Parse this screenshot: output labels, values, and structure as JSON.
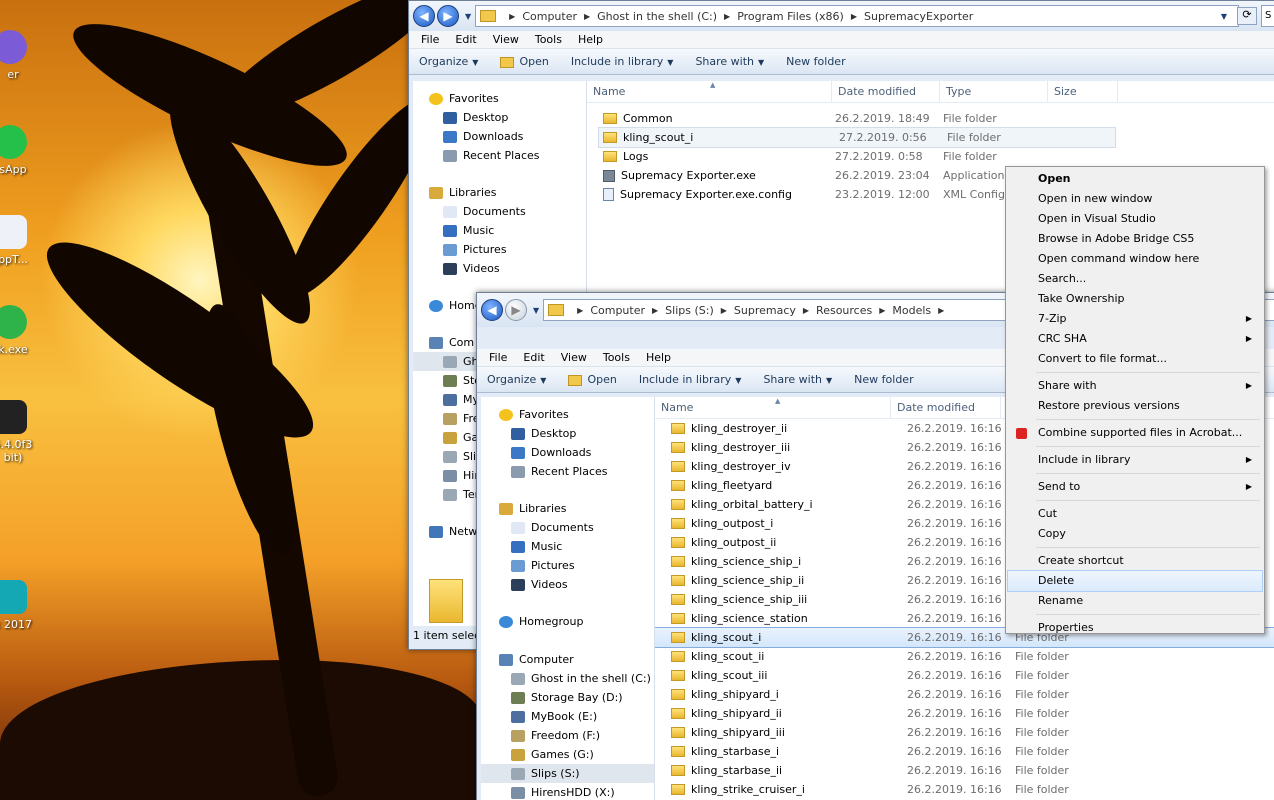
{
  "desktop": {
    "icons": [
      {
        "label": "er",
        "color": "#7b5cd6"
      },
      {
        "label": "sApp",
        "color": "#25c04a"
      },
      {
        "label": "ppT...",
        "color": "#eef2f8"
      },
      {
        "label": "k.exe",
        "color": "#2db34a"
      },
      {
        "label": "5.4.0f3\nbit)",
        "color": "#222222"
      },
      {
        "label": "x 2017",
        "color": "#14a8b5"
      }
    ]
  },
  "back_window": {
    "breadcrumbs": [
      "Computer",
      "Ghost in the shell (C:)",
      "Program Files (x86)",
      "SupremacyExporter"
    ],
    "menu": [
      "File",
      "Edit",
      "View",
      "Tools",
      "Help"
    ],
    "toolbar": {
      "organize": "Organize",
      "open": "Open",
      "include": "Include in library",
      "share": "Share with",
      "newfolder": "New folder"
    },
    "nav": {
      "favorites": "Favorites",
      "fav_items": [
        "Desktop",
        "Downloads",
        "Recent Places"
      ],
      "libraries": "Libraries",
      "lib_items": [
        "Documents",
        "Music",
        "Pictures",
        "Videos"
      ],
      "homegroup": "Homegroup",
      "computer_partial": [
        "Com",
        "Gho",
        "Sto",
        "My",
        "Fre",
        "Gar",
        "Slip",
        "Hir",
        "Ter"
      ],
      "network_partial": "Netw"
    },
    "columns": [
      "Name",
      "Date modified",
      "Type",
      "Size"
    ],
    "rows": [
      {
        "name": "Common",
        "date": "26.2.2019. 18:49",
        "type": "File folder",
        "icon": "folder"
      },
      {
        "name": "kling_scout_i",
        "date": "27.2.2019. 0:56",
        "type": "File folder",
        "icon": "folder"
      },
      {
        "name": "Logs",
        "date": "27.2.2019. 0:58",
        "type": "File folder",
        "icon": "folder"
      },
      {
        "name": "Supremacy Exporter.exe",
        "date": "26.2.2019. 23:04",
        "type": "Application",
        "icon": "exe"
      },
      {
        "name": "Supremacy Exporter.exe.config",
        "date": "23.2.2019. 12:00",
        "type": "XML Configu",
        "icon": "config"
      }
    ],
    "status": "1 item select",
    "search_partial": "S"
  },
  "front_window": {
    "breadcrumbs": [
      "Computer",
      "Slips (S:)",
      "Supremacy",
      "Resources",
      "Models"
    ],
    "menu": [
      "File",
      "Edit",
      "View",
      "Tools",
      "Help"
    ],
    "toolbar": {
      "organize": "Organize",
      "open": "Open",
      "include": "Include in library",
      "share": "Share with",
      "newfolder": "New folder"
    },
    "nav": {
      "favorites": "Favorites",
      "fav_items": [
        "Desktop",
        "Downloads",
        "Recent Places"
      ],
      "libraries": "Libraries",
      "lib_items": [
        "Documents",
        "Music",
        "Pictures",
        "Videos"
      ],
      "homegroup": "Homegroup",
      "computer": "Computer",
      "drives": [
        "Ghost in the shell (C:)",
        "Storage Bay (D:)",
        "MyBook (E:)",
        "Freedom (F:)",
        "Games (G:)",
        "Slips (S:)",
        "HirensHDD (X:)"
      ]
    },
    "columns": [
      "Name",
      "Date modified"
    ],
    "rows": [
      {
        "name": "kling_destroyer_ii",
        "date": "26.2.2019. 16:16",
        "type": ""
      },
      {
        "name": "kling_destroyer_iii",
        "date": "26.2.2019. 16:16",
        "type": ""
      },
      {
        "name": "kling_destroyer_iv",
        "date": "26.2.2019. 16:16",
        "type": ""
      },
      {
        "name": "kling_fleetyard",
        "date": "26.2.2019. 16:16",
        "type": ""
      },
      {
        "name": "kling_orbital_battery_i",
        "date": "26.2.2019. 16:16",
        "type": ""
      },
      {
        "name": "kling_outpost_i",
        "date": "26.2.2019. 16:16",
        "type": ""
      },
      {
        "name": "kling_outpost_ii",
        "date": "26.2.2019. 16:16",
        "type": ""
      },
      {
        "name": "kling_science_ship_i",
        "date": "26.2.2019. 16:16",
        "type": ""
      },
      {
        "name": "kling_science_ship_ii",
        "date": "26.2.2019. 16:16",
        "type": ""
      },
      {
        "name": "kling_science_ship_iii",
        "date": "26.2.2019. 16:16",
        "type": ""
      },
      {
        "name": "kling_science_station",
        "date": "26.2.2019. 16:16",
        "type": ""
      },
      {
        "name": "kling_scout_i",
        "date": "26.2.2019. 16:16",
        "type": "File folder"
      },
      {
        "name": "kling_scout_ii",
        "date": "26.2.2019. 16:16",
        "type": "File folder"
      },
      {
        "name": "kling_scout_iii",
        "date": "26.2.2019. 16:16",
        "type": "File folder"
      },
      {
        "name": "kling_shipyard_i",
        "date": "26.2.2019. 16:16",
        "type": "File folder"
      },
      {
        "name": "kling_shipyard_ii",
        "date": "26.2.2019. 16:16",
        "type": "File folder"
      },
      {
        "name": "kling_shipyard_iii",
        "date": "26.2.2019. 16:16",
        "type": "File folder"
      },
      {
        "name": "kling_starbase_i",
        "date": "26.2.2019. 16:16",
        "type": "File folder"
      },
      {
        "name": "kling_starbase_ii",
        "date": "26.2.2019. 16:16",
        "type": "File folder"
      },
      {
        "name": "kling_strike_cruiser_i",
        "date": "26.2.2019. 16:16",
        "type": "File folder"
      }
    ]
  },
  "context_menu": {
    "groups": [
      [
        "Open",
        "Open in new window",
        "Open in Visual Studio",
        "Browse in Adobe Bridge CS5",
        "Open command window here",
        "Search...",
        "Take Ownership",
        "7-Zip",
        "CRC SHA",
        "Convert to file format..."
      ],
      [
        "Share with",
        "Restore previous versions"
      ],
      [
        "Combine supported files in Acrobat..."
      ],
      [
        "Include in library"
      ],
      [
        "Send to"
      ],
      [
        "Cut",
        "Copy"
      ],
      [
        "Create shortcut",
        "Delete",
        "Rename"
      ],
      [
        "Properties"
      ]
    ],
    "submenu_items": [
      "7-Zip",
      "CRC SHA",
      "Share with",
      "Include in library",
      "Send to"
    ],
    "bold_item": "Open",
    "highlighted_item": "Delete"
  }
}
